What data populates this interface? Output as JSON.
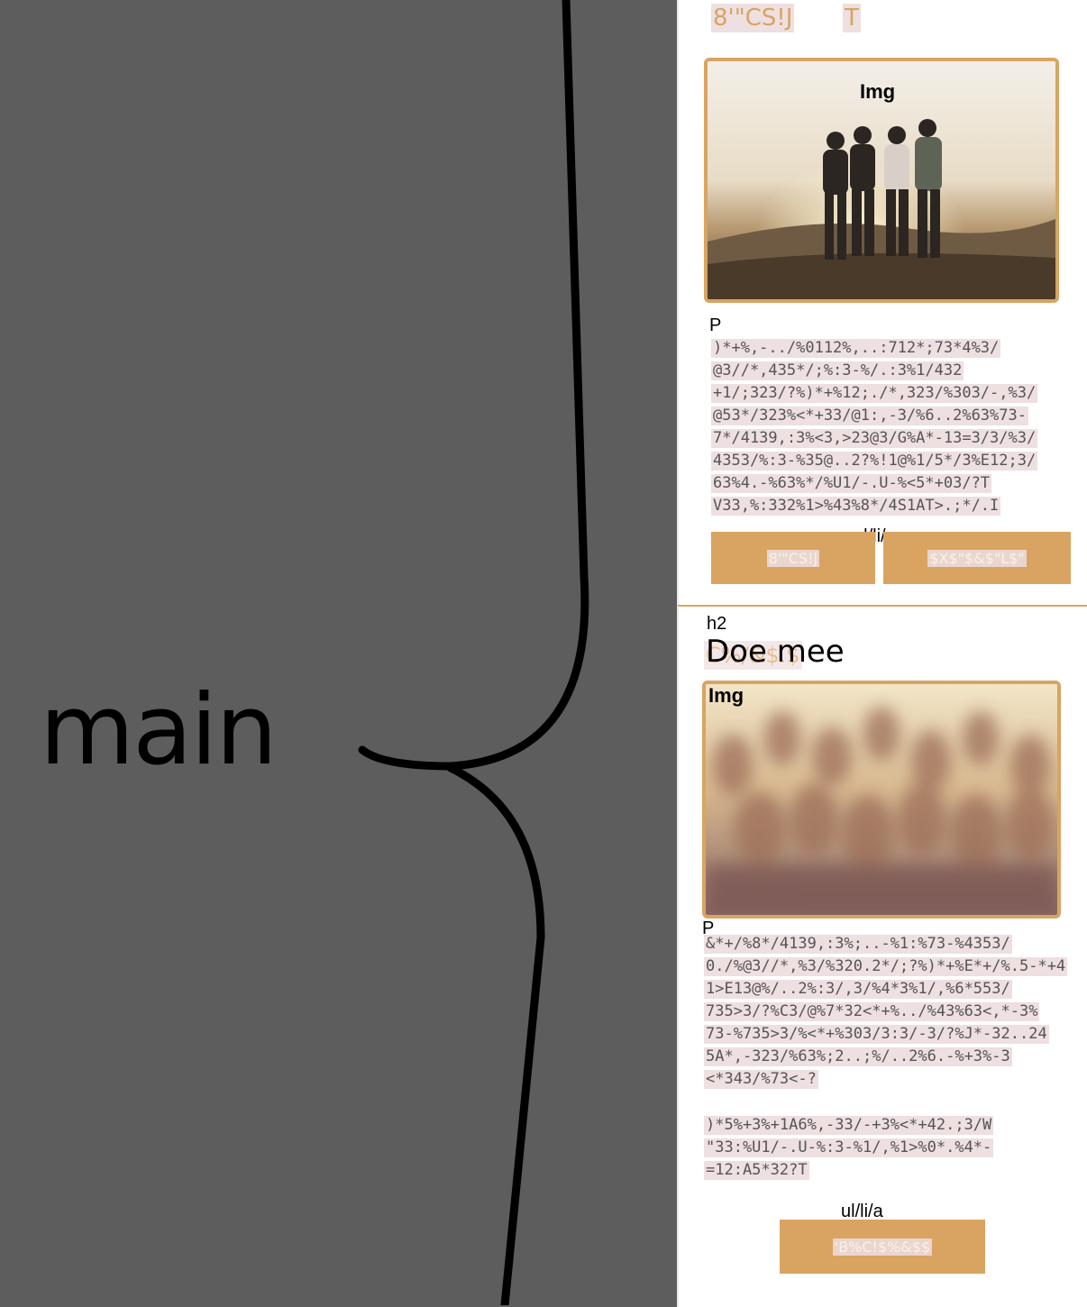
{
  "left": {
    "label": "main"
  },
  "top_section": {
    "nav_items": [
      "8'\"CS!J",
      "T"
    ],
    "image_tag": "Img",
    "p_tag": "P",
    "paragraph_lines": [
      ")*+%,-../%0112%,..:712*;73*4%3/",
      "@3//*,435*/;%:3-%/.:3%1/432",
      "+1/;323/?%)*+%12;./*,323/%303/-,%3/",
      "@53*/323%<*+33/@1:,-3/%6..2%63%73-",
      "7*/4139,:3%<3,>23@3/G%A*-13=3/3/%3/",
      "4353/%:3-%35@..2?%!1@%1/5*/3%E12;3/",
      "63%4.-%63%*/%U1/-.U-%<5*+03/?T",
      "V33,%:332%1>%43%8*/4S1AT>.;*/.I"
    ],
    "list_tag": "ul/li/a",
    "buttons": [
      "8'\"CS!J",
      "$X$\"$&$\"L$\""
    ]
  },
  "bottom_section": {
    "h2_tag": "h2",
    "heading_hidden": "C%/&$.$",
    "heading": "Doe mee",
    "image_tag": "Img",
    "p_tag": "P",
    "paragraph_lines": [
      "&*+/%8*/4139,:3%;..-%1:%73-%4353/",
      "0./%@3//*,%3/%320.2*/;?%)*+%E*+/%.5-*+4",
      "1>E13@%/..2%:3/,3/%4*3%1/,%6*553/",
      "735>3/?%C3/@%7*32<*+%../%43%63<,*-3%",
      "73-%735>3/%<*+%303/3:3/-3/?%J*-32..24",
      "5A*,-323/%63%;2..;%/..2%6.-%+3%-3",
      "<*343/%73<-?",
      ")*5%+3%+1A6%,-33/-+3%<*+42.;3/W",
      "\"33:%U1/-.U-%:3-%1/,%1>%0*.%4*-",
      "=12:A5*32?T"
    ],
    "list_tag": "ul/li/a",
    "button": "'B%C!$%&$$"
  },
  "colors": {
    "accent": "#d9a461",
    "highlight": "#eedfe1",
    "background": "#5d5d5d"
  }
}
